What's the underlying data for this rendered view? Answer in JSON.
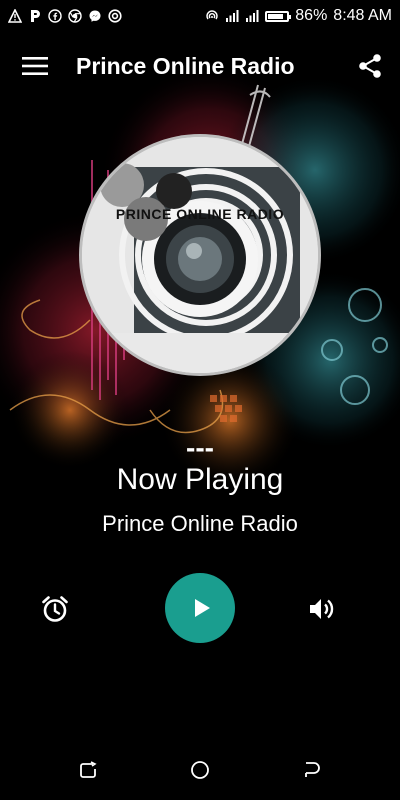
{
  "status_bar": {
    "battery": "86%",
    "battery_level": 0.86,
    "time": "8:48 AM",
    "left_icons": [
      "alert-icon",
      "p-app-icon",
      "facebook-icon",
      "chrome-icon",
      "messenger-icon",
      "settings-ring-icon"
    ],
    "right_icons": [
      "hotspot-icon",
      "signal-icon-1",
      "signal-icon-2",
      "battery-icon"
    ]
  },
  "app_bar": {
    "title": "Prince Online Radio",
    "menu_icon": "menu-icon",
    "share_icon": "share-icon"
  },
  "artwork": {
    "logo_text": "PRINCE ONLINE RADIO"
  },
  "player": {
    "track_title": "---",
    "status": "Now Playing",
    "station": "Prince Online Radio",
    "accent_color": "#1a9e8f",
    "controls": {
      "alarm_icon": "alarm-clock-icon",
      "play_icon": "play-icon",
      "volume_icon": "volume-icon"
    }
  },
  "nav_bar": {
    "icons": [
      "recents-icon",
      "home-icon",
      "back-icon"
    ]
  }
}
